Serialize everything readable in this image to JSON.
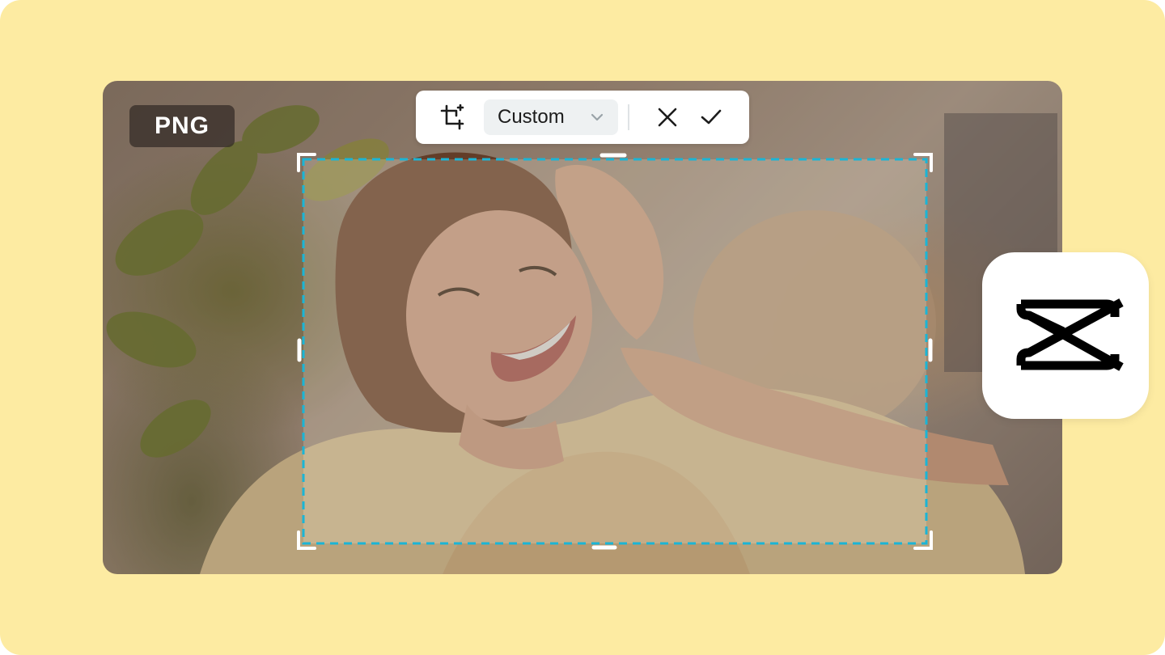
{
  "format_badge": {
    "label": "PNG"
  },
  "toolbar": {
    "crop_tool_icon": "crop-icon",
    "ratio_select": {
      "value": "Custom",
      "icon": "chevron-down-icon"
    },
    "cancel_icon": "close-icon",
    "confirm_icon": "check-icon"
  },
  "crop_frame": {
    "border_color": "#1AB5D6",
    "handle_color": "#ffffff"
  },
  "brand": {
    "icon": "capcut-logo-icon",
    "color": "#000000"
  },
  "colors": {
    "background": "#FDEBA2",
    "toolbar_bg": "#FFFFFF",
    "select_bg": "#EEF1F2"
  }
}
